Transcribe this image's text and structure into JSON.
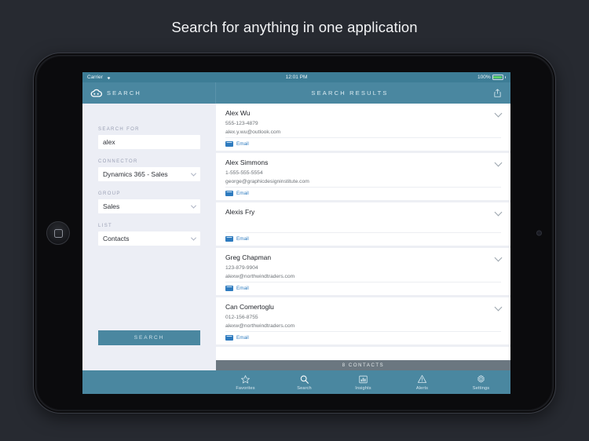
{
  "page": {
    "title": "Search for anything in one application"
  },
  "device": {
    "home_button": "home-button",
    "camera": "front-camera"
  },
  "status_bar": {
    "carrier": "Carrier",
    "wifi_icon": "wifi-icon",
    "time": "12:01 PM",
    "battery_percent": "100%",
    "battery_icon": "battery-full-icon"
  },
  "header": {
    "brand": "SEARCH",
    "logo_icon": "cloud-logo-icon",
    "title": "SEARCH RESULTS",
    "share_icon": "share-icon"
  },
  "sidebar": {
    "fields": [
      {
        "label": "SEARCH FOR",
        "value": "alex",
        "type": "text"
      },
      {
        "label": "CONNECTOR",
        "value": "Dynamics 365 - Sales",
        "type": "select"
      },
      {
        "label": "GROUP",
        "value": "Sales",
        "type": "select"
      },
      {
        "label": "LIST",
        "value": "Contacts",
        "type": "select"
      }
    ],
    "search_button": "SEARCH"
  },
  "results": {
    "action_label": "Email",
    "action_icon": "envelope-icon",
    "expand_icon": "chevron-down-icon",
    "footer": "8 CONTACTS",
    "items": [
      {
        "name": "Alex Wu",
        "phone": "555-123-4879",
        "email": "alex.y.wu@outlook.com"
      },
      {
        "name": "Alex Simmons",
        "phone": "1-555-555-5554",
        "email": "george@graphicdesigninstitute.com"
      },
      {
        "name": "Alexis Fry",
        "phone": "",
        "email": ""
      },
      {
        "name": "Greg Chapman",
        "phone": "123-879-9904",
        "email": "alexw@northwindtraders.com"
      },
      {
        "name": "Can Comertoglu",
        "phone": "012-156-8755",
        "email": "alexw@northwindtraders.com"
      }
    ]
  },
  "tab_bar": {
    "items": [
      {
        "label": "Favorites",
        "icon": "star-icon"
      },
      {
        "label": "Search",
        "icon": "search-icon"
      },
      {
        "label": "Insights",
        "icon": "bar-chart-icon"
      },
      {
        "label": "Alerts",
        "icon": "alert-icon"
      },
      {
        "label": "Settings",
        "icon": "gear-icon"
      }
    ]
  },
  "colors": {
    "accent": "#4a87a0",
    "status_bar": "#3d7d96",
    "sidebar": "#eceef5",
    "link": "#2e7bbf",
    "footer": "#6b7780",
    "battery": "#5ed06a"
  }
}
